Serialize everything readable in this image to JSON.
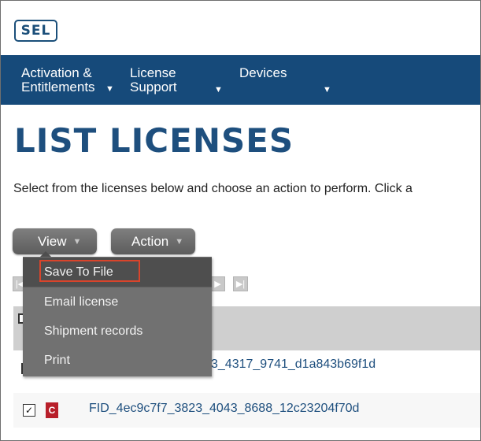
{
  "header": {
    "logo_text": "SEL"
  },
  "nav": {
    "items": [
      {
        "line1": "Activation &",
        "line2": "Entitlements"
      },
      {
        "line1": "License",
        "line2": "Support"
      },
      {
        "line1": "Devices",
        "line2": ""
      }
    ]
  },
  "main": {
    "title": "LIST LICENSES",
    "instructions": "Select from the licenses below and choose an action to perform. Click a",
    "buttons": {
      "view": "View",
      "action": "Action"
    }
  },
  "view_menu": {
    "items": [
      {
        "label": "Save To File",
        "highlighted": true
      },
      {
        "label": "Email license",
        "highlighted": false
      },
      {
        "label": "Shipment records",
        "highlighted": false
      },
      {
        "label": "Print",
        "highlighted": false
      }
    ]
  },
  "table": {
    "rows": [
      {
        "id_text": "3_4317_9741_d1a843b69f1d",
        "checked": false,
        "badge": ""
      },
      {
        "id_text": "FID_4ec9c7f7_3823_4043_8688_12c23204f70d",
        "checked": true,
        "badge": "C"
      }
    ]
  },
  "colors": {
    "nav_bg": "#164a7a",
    "title": "#1e4f7e",
    "menu_bg": "#717171",
    "highlight_border": "#d9442b",
    "badge_bg": "#b81f2a"
  },
  "icons": {
    "nav_caret": "caret-down-icon",
    "button_caret": "caret-down-icon",
    "pager": [
      "first-page-icon",
      "last-page-icon",
      "next-page-icon"
    ]
  }
}
